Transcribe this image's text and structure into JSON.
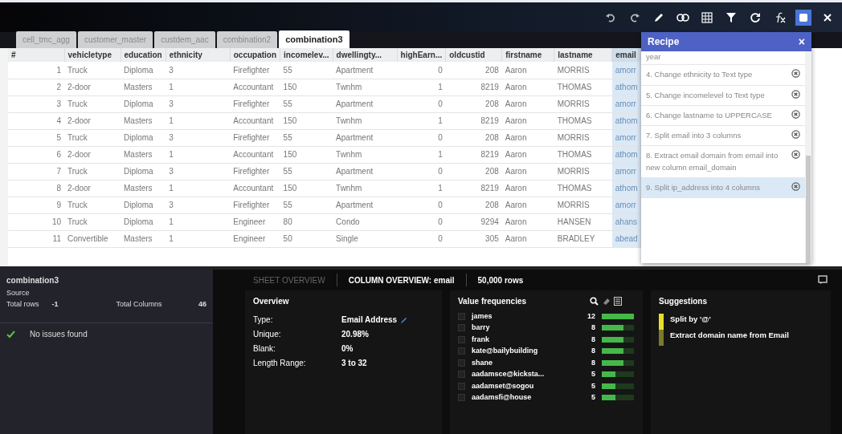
{
  "toolbar": {
    "recipe_toggle": {
      "selected": true
    }
  },
  "tabs": [
    {
      "label": "cell_tmc_agg",
      "selected": false
    },
    {
      "label": "customer_master",
      "selected": false
    },
    {
      "label": "custdem_aac",
      "selected": false
    },
    {
      "label": "combination2",
      "selected": false
    },
    {
      "label": "combination3",
      "selected": true
    }
  ],
  "table": {
    "columns": [
      {
        "label": "#",
        "kind": "number",
        "selected": false
      },
      {
        "label": "vehicletype",
        "kind": "text",
        "selected": false
      },
      {
        "label": "education",
        "kind": "text",
        "selected": false
      },
      {
        "label": "ethnicity",
        "kind": "text",
        "selected": false
      },
      {
        "label": "occupation",
        "kind": "text",
        "selected": false
      },
      {
        "label": "incomelev...",
        "kind": "text",
        "selected": false
      },
      {
        "label": "dwellingty...",
        "kind": "text",
        "selected": false
      },
      {
        "label": "highEarn...",
        "kind": "number",
        "selected": false
      },
      {
        "label": "oldcustid",
        "kind": "number",
        "selected": false
      },
      {
        "label": "firstname",
        "kind": "text",
        "selected": false
      },
      {
        "label": "lastname",
        "kind": "text",
        "selected": false
      },
      {
        "label": "email",
        "kind": "text",
        "selected": true
      }
    ],
    "rows": [
      {
        "cells": [
          "1",
          "Truck",
          "Diploma",
          "3",
          "Firefighter",
          "55",
          "Apartment",
          "0",
          "208",
          "Aaron",
          "MORRIS",
          "amorr"
        ]
      },
      {
        "cells": [
          "2",
          "2-door",
          "Masters",
          "1",
          "Accountant",
          "150",
          "Twnhm",
          "1",
          "8219",
          "Aaron",
          "THOMAS",
          "athom"
        ]
      },
      {
        "cells": [
          "3",
          "Truck",
          "Diploma",
          "3",
          "Firefighter",
          "55",
          "Apartment",
          "0",
          "208",
          "Aaron",
          "MORRIS",
          "amorr"
        ]
      },
      {
        "cells": [
          "4",
          "2-door",
          "Masters",
          "1",
          "Accountant",
          "150",
          "Twnhm",
          "1",
          "8219",
          "Aaron",
          "THOMAS",
          "athom"
        ]
      },
      {
        "cells": [
          "5",
          "Truck",
          "Diploma",
          "3",
          "Firefighter",
          "55",
          "Apartment",
          "0",
          "208",
          "Aaron",
          "MORRIS",
          "amorr"
        ]
      },
      {
        "cells": [
          "6",
          "2-door",
          "Masters",
          "1",
          "Accountant",
          "150",
          "Twnhm",
          "1",
          "8219",
          "Aaron",
          "THOMAS",
          "athom"
        ]
      },
      {
        "cells": [
          "7",
          "Truck",
          "Diploma",
          "3",
          "Firefighter",
          "55",
          "Apartment",
          "0",
          "208",
          "Aaron",
          "MORRIS",
          "amorr"
        ]
      },
      {
        "cells": [
          "8",
          "2-door",
          "Masters",
          "1",
          "Accountant",
          "150",
          "Twnhm",
          "1",
          "8219",
          "Aaron",
          "THOMAS",
          "athom"
        ]
      },
      {
        "cells": [
          "9",
          "Truck",
          "Diploma",
          "3",
          "Firefighter",
          "55",
          "Apartment",
          "0",
          "208",
          "Aaron",
          "MORRIS",
          "amorr"
        ]
      },
      {
        "cells": [
          "10",
          "Truck",
          "Diploma",
          "1",
          "Engineer",
          "80",
          "Condo",
          "0",
          "9294",
          "Aaron",
          "HANSEN",
          "ahans"
        ]
      },
      {
        "cells": [
          "11",
          "Convertible",
          "Masters",
          "1",
          "Engineer",
          "50",
          "Single",
          "0",
          "305",
          "Aaron",
          "BRADLEY",
          "abead"
        ]
      }
    ]
  },
  "recipe": {
    "title": "Recipe",
    "close": "×",
    "steps": [
      {
        "kind": "cut",
        "text": "year",
        "selected": false
      },
      {
        "kind": "step",
        "text": "4. Change ethnicity to Text type",
        "selected": false
      },
      {
        "kind": "step",
        "text": "5. Change incomelevel to Text type",
        "selected": false
      },
      {
        "kind": "step",
        "text": "6. Change lastname to UPPERCASE",
        "selected": false
      },
      {
        "kind": "step",
        "text": "7. Split email into 3 columns",
        "selected": false
      },
      {
        "kind": "step",
        "text": "8. Extract email domain from email into new column email_domain",
        "selected": false
      },
      {
        "kind": "step",
        "text": "9. Split ip_address into 4 columns",
        "selected": true
      }
    ]
  },
  "sheet_info": {
    "name": "combination3",
    "source_label": "Source",
    "total_rows_label": "Total rows",
    "total_rows": "-1",
    "total_columns_label": "Total Columns",
    "total_columns": "46",
    "issues": "No issues found"
  },
  "overview_tabs": [
    {
      "label": "SHEET OVERVIEW",
      "selected": false
    },
    {
      "label": "COLUMN OVERVIEW: email",
      "selected": true
    }
  ],
  "row_count": "50,000 rows",
  "overview": {
    "title": "Overview",
    "fields": [
      {
        "label": "Type:",
        "value": "Email Address"
      },
      {
        "label": "Unique:",
        "value": "20.98%"
      },
      {
        "label": "Blank:",
        "value": "0%"
      },
      {
        "label": "Length Range:",
        "value": "3 to 32"
      }
    ]
  },
  "value_frequencies": {
    "title": "Value frequencies",
    "items": [
      {
        "value": "james",
        "count": "12",
        "level": 1,
        "checked": false
      },
      {
        "value": "barry",
        "count": "8",
        "level": 0.67,
        "checked": false
      },
      {
        "value": "frank",
        "count": "8",
        "level": 0.67,
        "checked": false
      },
      {
        "value": "kate@bailybuilding",
        "count": "8",
        "level": 0.67,
        "checked": false
      },
      {
        "value": "shane",
        "count": "8",
        "level": 0.67,
        "checked": false
      },
      {
        "value": "aadamsce@kicksta...",
        "count": "5",
        "level": 0.42,
        "checked": false
      },
      {
        "value": "aadamset@sogou",
        "count": "5",
        "level": 0.42,
        "checked": false
      },
      {
        "value": "aadamsfi@house",
        "count": "5",
        "level": 0.42,
        "checked": false
      }
    ]
  },
  "suggestions": {
    "title": "Suggestions",
    "items": [
      {
        "text": "Split by '@'",
        "selected": true
      },
      {
        "text": "Extract domain name from Email",
        "selected": false
      }
    ]
  }
}
